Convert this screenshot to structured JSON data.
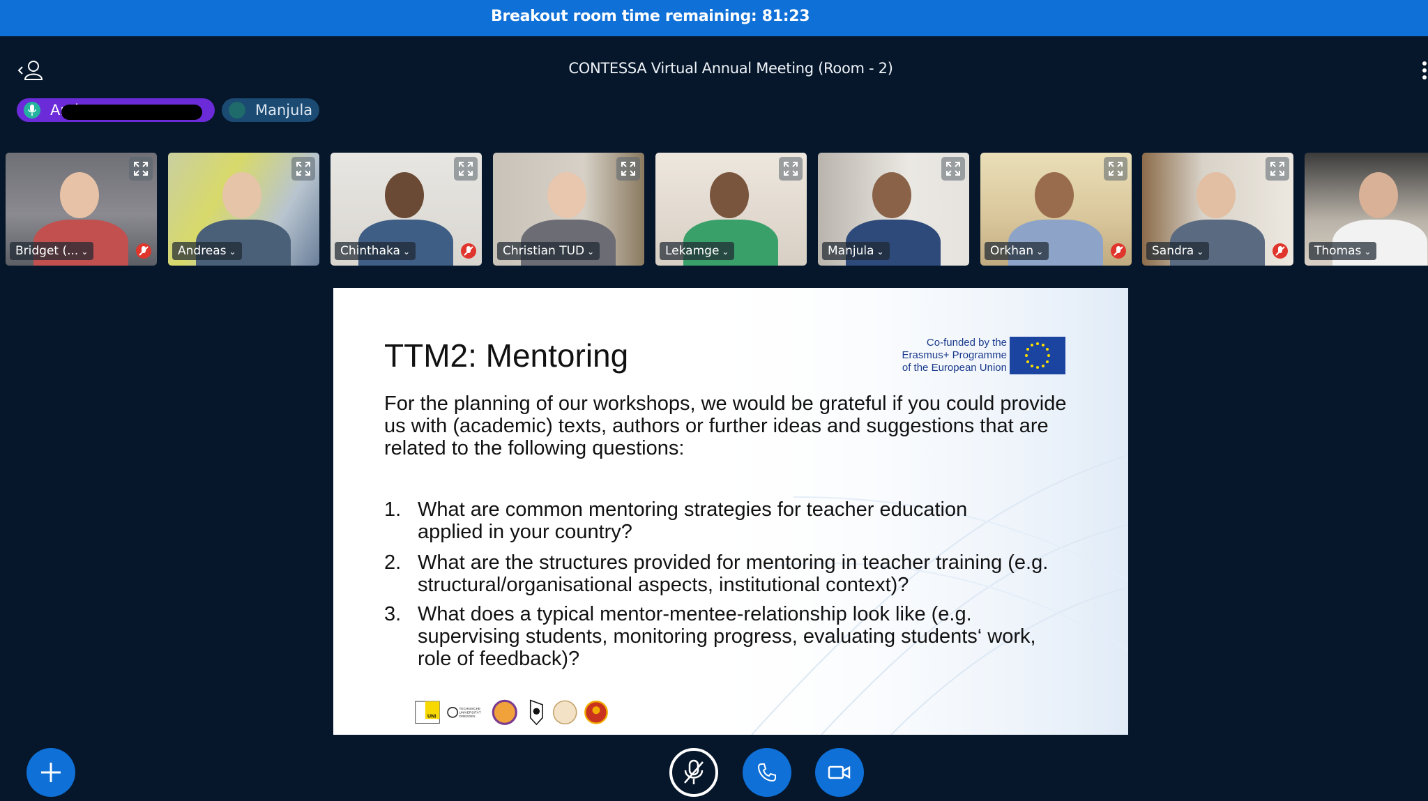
{
  "banner": {
    "text": "Breakout room time remaining: 81:23"
  },
  "header": {
    "title": "CONTESSA Virtual Annual Meeting (Room - 2)"
  },
  "talkers": [
    {
      "label": "And"
    },
    {
      "label": "Manjula"
    }
  ],
  "participants": [
    {
      "name": "Bridget (...",
      "muted": true
    },
    {
      "name": "Andreas",
      "muted": false
    },
    {
      "name": "Chinthaka",
      "muted": true
    },
    {
      "name": "Christian TUD",
      "muted": false
    },
    {
      "name": "Lekamge",
      "muted": false
    },
    {
      "name": "Manjula",
      "muted": false
    },
    {
      "name": "Orkhan",
      "muted": true
    },
    {
      "name": "Sandra",
      "muted": true
    },
    {
      "name": "Thomas",
      "muted": false
    }
  ],
  "slide": {
    "title": "TTM2: Mentoring",
    "eu_line1": "Co-funded by the",
    "eu_line2": "Erasmus+ Programme",
    "eu_line3": "of the European Union",
    "intro": "For the planning of our workshops, we would be grateful if you could provide us with (academic) texts, authors or further ideas and suggestions that are related to the following questions:",
    "questions": [
      {
        "num": "1.",
        "text": "What are common mentoring strategies for teacher education applied in your country?"
      },
      {
        "num": "2.",
        "text": "What are the structures provided for mentoring in teacher training (e.g. structural/organisational aspects, institutional context)?"
      },
      {
        "num": "3.",
        "text": "What does a typical mentor-mentee-relationship look like (e.g. supervising students, monitoring progress, evaluating students‘ work, role of feedback)?"
      }
    ],
    "logo_tud": "TECHNISCHE UNIVERSITÄT DRESDEN"
  },
  "icons": {
    "actions": "plus-icon",
    "mic": "mic-off-icon",
    "phone": "phone-icon",
    "camera": "video-camera-icon"
  },
  "colors": {
    "banner": "#0f70d7",
    "background": "#06172b",
    "talker_active": "#6c2bd9",
    "muted": "#e0352c"
  }
}
